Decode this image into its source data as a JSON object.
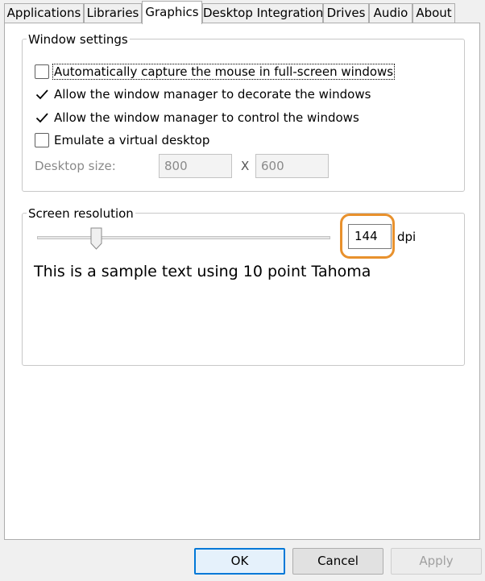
{
  "tabs": [
    {
      "label": "Applications",
      "active": false
    },
    {
      "label": "Libraries",
      "active": false
    },
    {
      "label": "Graphics",
      "active": true
    },
    {
      "label": "Desktop Integration",
      "active": false
    },
    {
      "label": "Drives",
      "active": false
    },
    {
      "label": "Audio",
      "active": false
    },
    {
      "label": "About",
      "active": false
    }
  ],
  "window_settings": {
    "title": "Window settings",
    "options": [
      {
        "label": "Automatically capture the mouse in full-screen windows",
        "checked": false
      },
      {
        "label": "Allow the window manager to decorate the windows",
        "checked": true
      },
      {
        "label": "Allow the window manager to control the windows",
        "checked": true
      },
      {
        "label": "Emulate a virtual desktop",
        "checked": false
      }
    ],
    "desktop_size_label": "Desktop size:",
    "width_value": "800",
    "separator": "X",
    "height_value": "600"
  },
  "screen_resolution": {
    "title": "Screen resolution",
    "dpi_value": "144",
    "dpi_unit": "dpi",
    "slider_level": 0.19,
    "sample_text": "This is a sample text using 10 point Tahoma"
  },
  "buttons": {
    "ok": "OK",
    "cancel": "Cancel",
    "apply": "Apply"
  },
  "colors": {
    "highlight": "#e8912d",
    "default_button_border": "#0078d7"
  }
}
